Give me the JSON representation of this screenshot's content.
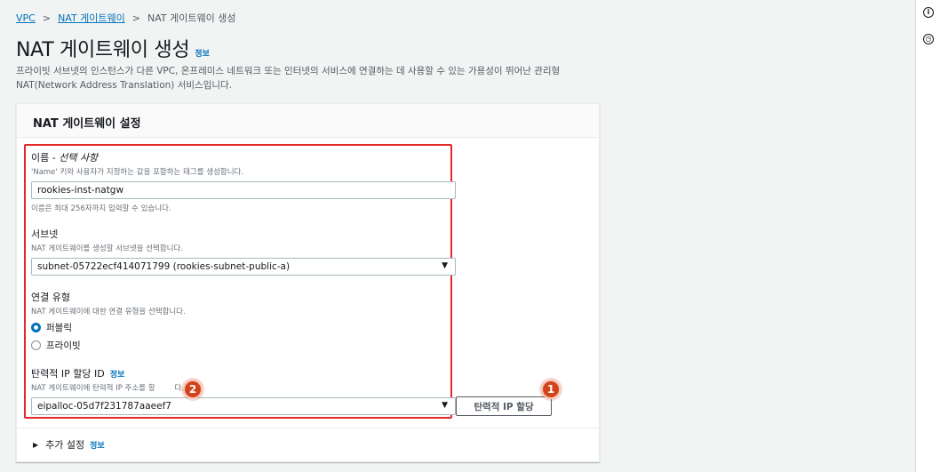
{
  "breadcrumb": {
    "items": [
      "VPC",
      "NAT 게이트웨이"
    ],
    "current": "NAT 게이트웨이 생성",
    "separator": ">"
  },
  "page": {
    "title": "NAT 게이트웨이 생성",
    "info": "정보",
    "description": "프라이빗 서브넷의 인스턴스가 다른 VPC, 온프레미스 네트워크 또는 인터넷의 서비스에 연결하는 데 사용할 수 있는 가용성이 뛰어난 관리형 NAT(Network Address Translation) 서비스입니다."
  },
  "panel": {
    "title": "NAT 게이트웨이 설정",
    "name_field": {
      "label": "이름 - ",
      "label_optional": "선택 사항",
      "description": "'Name' 키와 사용자가 지정하는 값을 포함하는 태그를 생성합니다.",
      "value": "rookies-inst-natgw",
      "hint": "이름은 최대 256자까지 입력할 수 있습니다."
    },
    "subnet_field": {
      "label": "서브넷",
      "description": "NAT 게이트웨이를 생성할 서브넷을 선택합니다.",
      "value": "subnet-05722ecf414071799 (rookies-subnet-public-a)"
    },
    "connectivity_field": {
      "label": "연결 유형",
      "description": "NAT 게이트웨이에 대한 연결 유형을 선택합니다.",
      "options": [
        "퍼블릭",
        "프라이빗"
      ],
      "selected": "퍼블릭"
    },
    "eip_field": {
      "label": "탄력적 IP 할당 ID",
      "info": "정보",
      "description": "NAT 게이트웨이에 탄력적 IP 주소를 할",
      "description_tail": "다.",
      "value": "eipalloc-05d7f231787aaeef7",
      "button": "탄력적 IP 할당"
    },
    "additional": {
      "label": "추가 설정",
      "info": "정보"
    }
  },
  "annotations": {
    "badge_1": "1",
    "badge_2": "2"
  },
  "colors": {
    "link": "#0073bb",
    "highlight": "#e5272d",
    "badge": "#d2421b"
  },
  "icons": {
    "right_top": "info-circle-icon",
    "right_second": "history-icon",
    "caret": "caret-down-icon"
  }
}
